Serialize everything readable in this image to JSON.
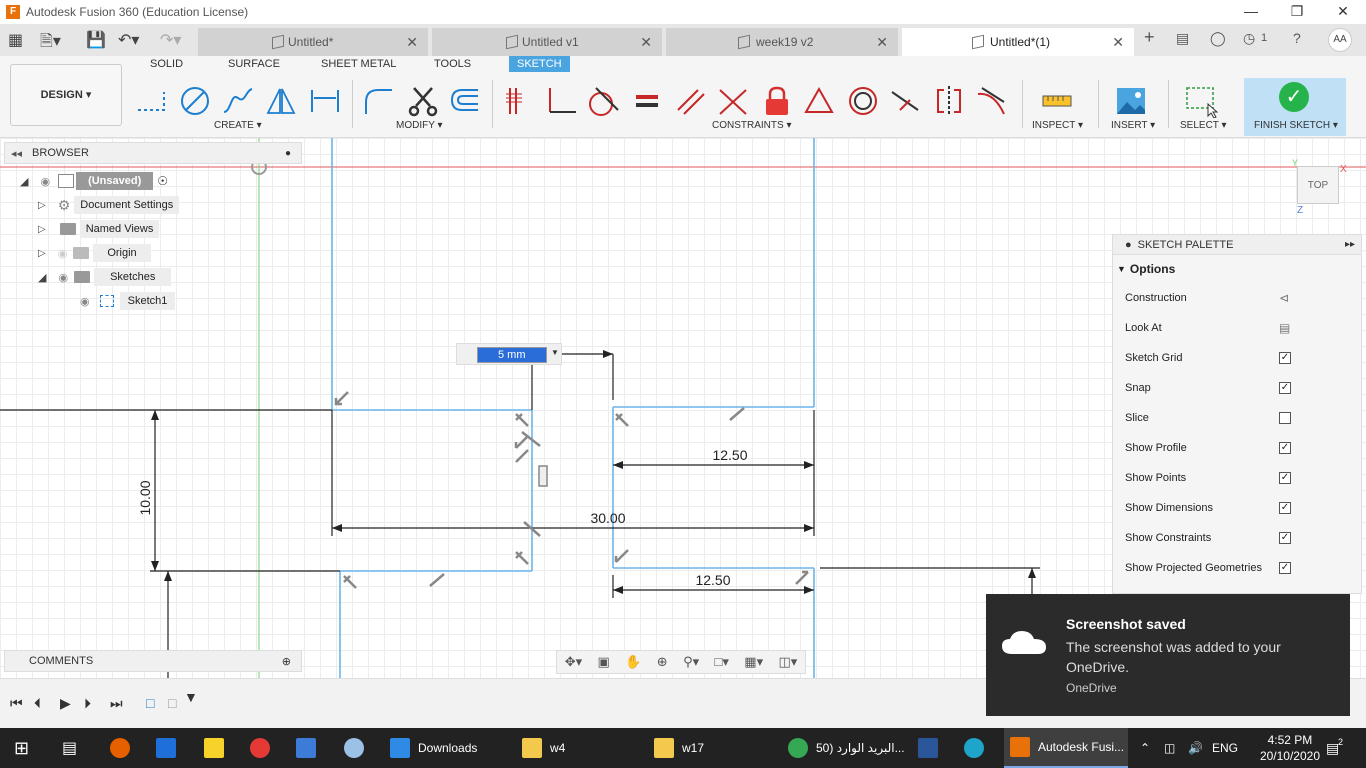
{
  "window": {
    "title": "Autodesk Fusion 360 (Education License)",
    "logo": "F"
  },
  "tabs": [
    {
      "label": "Untitled*"
    },
    {
      "label": "Untitled v1"
    },
    {
      "label": "week19 v2"
    },
    {
      "label": "Untitled*(1)"
    }
  ],
  "header_right": {
    "jobs_count": "1",
    "avatar": "AA"
  },
  "ribbon": {
    "workspace": "DESIGN",
    "workspace_tabs": [
      "SOLID",
      "SURFACE",
      "SHEET METAL",
      "TOOLS",
      "SKETCH"
    ],
    "groups": {
      "create": "CREATE",
      "modify": "MODIFY",
      "constraints": "CONSTRAINTS",
      "inspect": "INSPECT",
      "insert": "INSERT",
      "select": "SELECT",
      "finish": "FINISH SKETCH"
    }
  },
  "browser": {
    "title": "BROWSER",
    "items": [
      {
        "label": "(Unsaved)"
      },
      {
        "label": "Document Settings"
      },
      {
        "label": "Named Views"
      },
      {
        "label": "Origin"
      },
      {
        "label": "Sketches"
      },
      {
        "label": "Sketch1"
      }
    ]
  },
  "comments_label": "COMMENTS",
  "dimension_input": {
    "value": "5 mm"
  },
  "dimensions": {
    "d1": "10.00",
    "d2": "30.00",
    "d3": "12.50",
    "d4": "12.50"
  },
  "viewcube": {
    "face": "TOP",
    "axis_z": "Z",
    "axis_x": "X",
    "axis_y": "Y"
  },
  "palette": {
    "title": "SKETCH PALETTE",
    "section": "Options",
    "rows": [
      {
        "label": "Construction",
        "kind": "icon",
        "checked": false
      },
      {
        "label": "Look At",
        "kind": "icon",
        "checked": false
      },
      {
        "label": "Sketch Grid",
        "kind": "check",
        "checked": true
      },
      {
        "label": "Snap",
        "kind": "check",
        "checked": true
      },
      {
        "label": "Slice",
        "kind": "check",
        "checked": false
      },
      {
        "label": "Show Profile",
        "kind": "check",
        "checked": true
      },
      {
        "label": "Show Points",
        "kind": "check",
        "checked": true
      },
      {
        "label": "Show Dimensions",
        "kind": "check",
        "checked": true
      },
      {
        "label": "Show Constraints",
        "kind": "check",
        "checked": true
      },
      {
        "label": "Show Projected Geometries",
        "kind": "check",
        "checked": true
      }
    ]
  },
  "toast": {
    "title": "Screenshot saved",
    "message": "The screenshot was added to your OneDrive.",
    "source": "OneDrive"
  },
  "taskbar": {
    "items": [
      {
        "label": "Downloads"
      },
      {
        "label": "w4"
      },
      {
        "label": "w17"
      },
      {
        "label": "البريد الوارد (50..."
      },
      {
        "label": "Autodesk Fusi..."
      }
    ],
    "lang": "ENG",
    "time": "4:52 PM",
    "date": "20/10/2020",
    "notifications": "2"
  }
}
